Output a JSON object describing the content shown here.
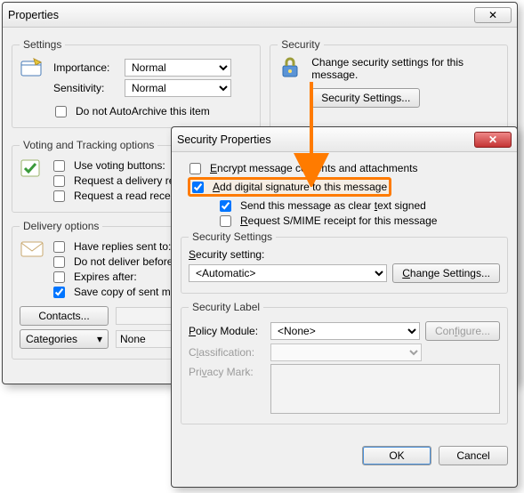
{
  "properties": {
    "title": "Properties",
    "close_glyph": "✕",
    "settings": {
      "legend": "Settings",
      "importance_label": "Importance:",
      "importance_value": "Normal",
      "sensitivity_label": "Sensitivity:",
      "sensitivity_value": "Normal",
      "auto_archive_label": "Do not AutoArchive this item",
      "auto_archive_checked": false
    },
    "security": {
      "legend": "Security",
      "desc": "Change security settings for this message.",
      "button": "Security Settings..."
    },
    "voting": {
      "legend": "Voting and Tracking options",
      "use_voting_label": "Use voting buttons:",
      "use_voting_checked": false,
      "request_delivery_label": "Request a delivery rece",
      "request_delivery_checked": false,
      "request_read_label": "Request a read receipt",
      "request_read_checked": false
    },
    "delivery": {
      "legend": "Delivery options",
      "have_replies_label": "Have replies sent to:",
      "have_replies_checked": false,
      "not_before_label": "Do not deliver before:",
      "not_before_checked": false,
      "expires_label": "Expires after:",
      "expires_checked": false,
      "save_copy_label": "Save copy of sent mes",
      "save_copy_checked": true,
      "contacts_btn": "Contacts...",
      "categories_btn": "Categories",
      "categories_value": "None"
    }
  },
  "secProps": {
    "title": "Security Properties",
    "close_glyph": "✕",
    "opts": {
      "encrypt": {
        "label": "Encrypt message contents and attachments",
        "checked": false
      },
      "sign": {
        "label": "Add digital signature to this message",
        "checked": true
      },
      "clear": {
        "label": "Send this message as clear text signed",
        "checked": true
      },
      "smime": {
        "label": "Request S/MIME receipt for this message",
        "checked": false
      }
    },
    "settings": {
      "legend": "Security Settings",
      "setting_label": "Security setting:",
      "setting_value": "<Automatic>",
      "change_btn": "Change Settings..."
    },
    "label": {
      "legend": "Security Label",
      "policy_label": "Policy Module:",
      "policy_value": "<None>",
      "configure_btn": "Configure...",
      "classification_label": "Classification:",
      "privacy_label": "Privacy Mark:"
    },
    "footer": {
      "ok": "OK",
      "cancel": "Cancel"
    }
  }
}
